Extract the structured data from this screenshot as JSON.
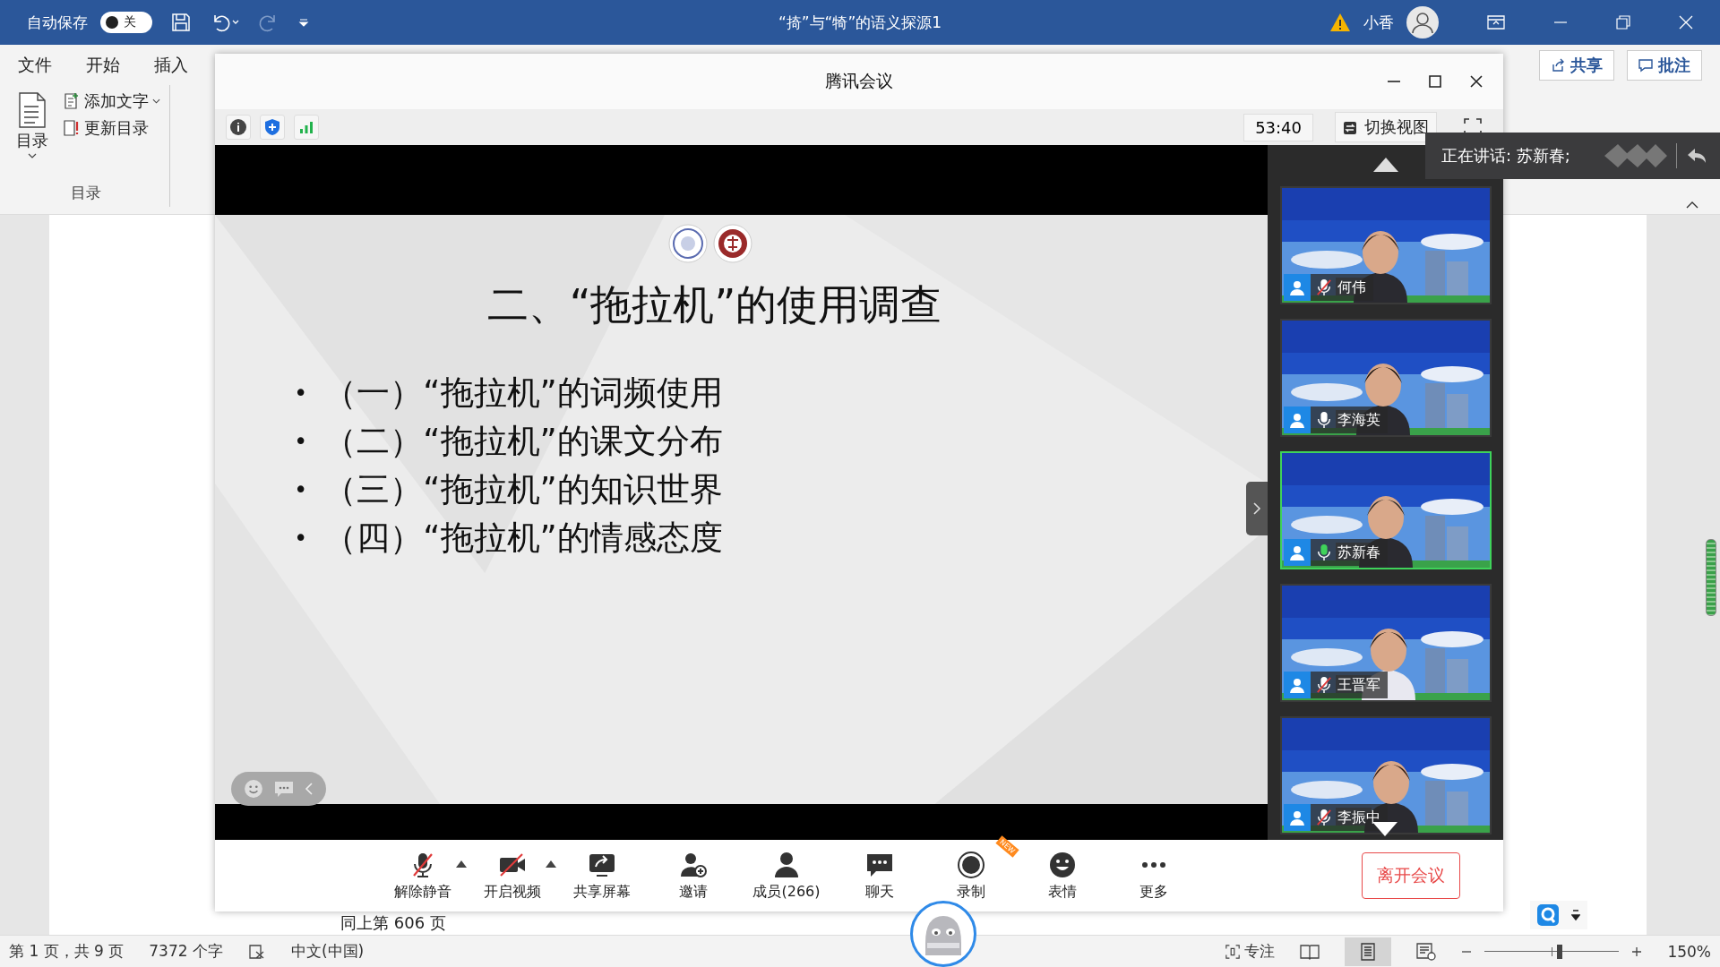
{
  "word": {
    "autosave": {
      "label": "自动保存",
      "on": false,
      "state": "关"
    },
    "title": "“掎”与“犄”的语义探源1",
    "user": "小香",
    "tabs": [
      "文件",
      "开始",
      "插入"
    ],
    "ribbon": {
      "toc": "目录",
      "add_text": "添加文字",
      "update_toc": "更新目录",
      "group": "目录"
    },
    "share": "共享",
    "comment": "批注",
    "page_text": "同上第 606 页",
    "status_bar": {
      "page": "第 1 页，共 9 页",
      "words": "7372 个字",
      "language": "中文(中国)",
      "focus": "专注",
      "zoom": {
        "level": 0.56,
        "reading": "150%"
      }
    }
  },
  "meeting": {
    "title": "腾讯会议",
    "timer": "53:40",
    "switch_view": "切换视图",
    "slide": {
      "title": "二、“拖拉机”的使用调查",
      "bullet_mark": "•",
      "bullets": [
        "（一）“拖拉机”的词频使用",
        "（二）“拖拉机”的课文分布",
        "（三）“拖拉机”的知识世界",
        "（四）“拖拉机”的情感态度"
      ]
    },
    "participants": [
      {
        "name": "何伟",
        "muted": true,
        "speaking": false
      },
      {
        "name": "李海英",
        "muted": false,
        "speaking": false
      },
      {
        "name": "苏新春",
        "muted": false,
        "speaking": true
      },
      {
        "name": "王晋军",
        "muted": true,
        "speaking": false
      },
      {
        "name": "李振中",
        "muted": true,
        "speaking": false
      }
    ],
    "speaker_tip": "正在讲话: 苏新春;",
    "toolbar": [
      {
        "kind": "mic",
        "label": "解除静音",
        "menu": true
      },
      {
        "kind": "video",
        "label": "开启视频",
        "menu": true
      },
      {
        "kind": "share",
        "label": "共享屏幕",
        "menu": false
      },
      {
        "kind": "invite",
        "label": "邀请",
        "menu": false
      },
      {
        "kind": "members",
        "label": "成员(266)",
        "menu": false
      },
      {
        "kind": "chat",
        "label": "聊天",
        "menu": false
      },
      {
        "kind": "record",
        "label": "录制",
        "menu": false,
        "badge": "NEW"
      },
      {
        "kind": "emoji",
        "label": "表情",
        "menu": false
      },
      {
        "kind": "more",
        "label": "更多",
        "menu": false
      }
    ],
    "leave": "离开会议"
  }
}
